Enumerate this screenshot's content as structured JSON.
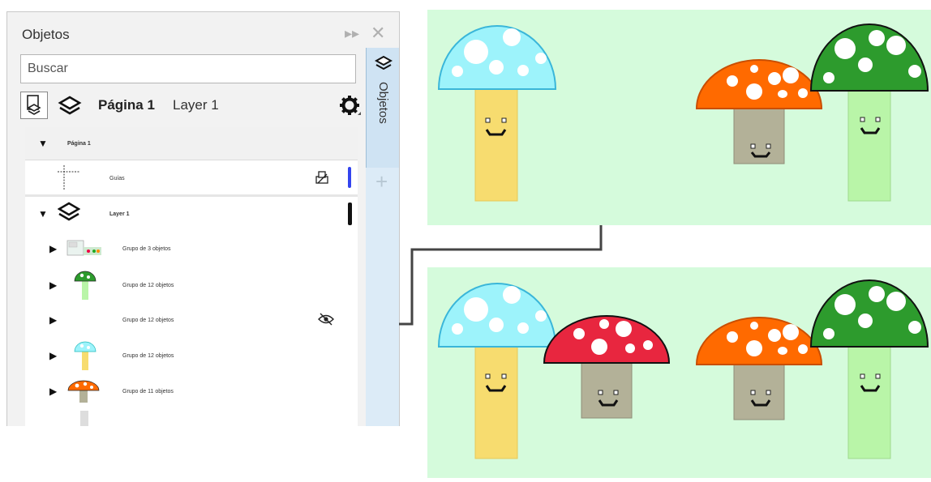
{
  "panel": {
    "title": "Objetos",
    "search_placeholder": "Buscar",
    "current_page": "Página 1",
    "current_layer": "Layer 1",
    "side_tab_label": "Objetos"
  },
  "tree": {
    "page_row": "Página 1",
    "guides_row": "Guías",
    "layer_row": "Layer 1",
    "items": [
      {
        "label": "Grupo de 3 objetos"
      },
      {
        "label": "Grupo de 12 objetos"
      },
      {
        "label": "Grupo de 12 objetos"
      },
      {
        "label": "Grupo de 12 objetos"
      },
      {
        "label": "Grupo de 11 objetos"
      }
    ]
  },
  "colors": {
    "canvas_bg": "#d5fbdc",
    "mushroom_cyan": "#9df3fb",
    "mushroom_orange": "#ff6a00",
    "mushroom_green": "#2d9b2d",
    "mushroom_red": "#e8263f",
    "stem_yellow": "#f7dc6f",
    "stem_gray": "#b3b198",
    "stem_light_green": "#b9f5a8",
    "guide_line_blue": "#3344ee"
  }
}
